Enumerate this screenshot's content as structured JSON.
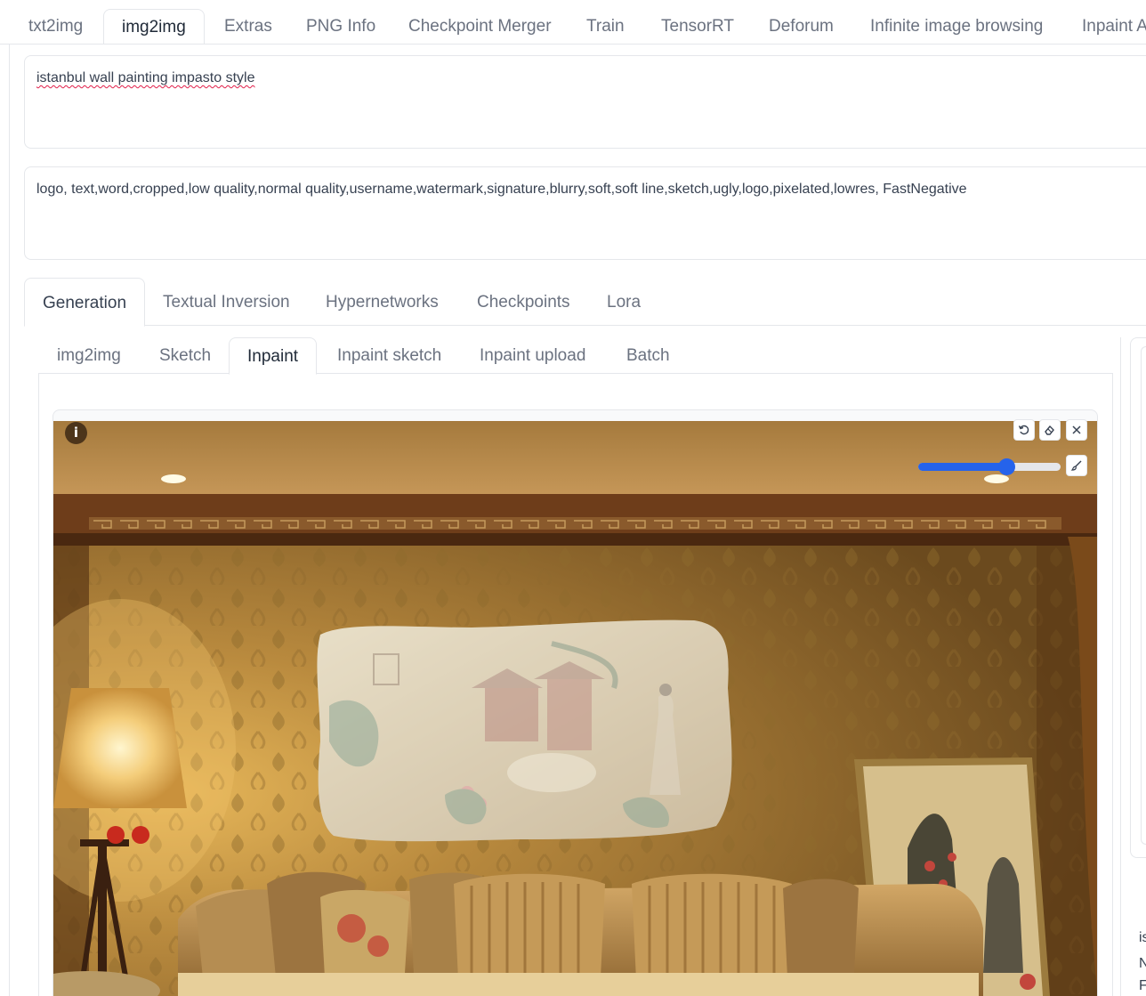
{
  "top_tabs": [
    "txt2img",
    "img2img",
    "Extras",
    "PNG Info",
    "Checkpoint Merger",
    "Train",
    "TensorRT",
    "Deforum",
    "Infinite image browsing",
    "Inpaint A"
  ],
  "prompt": {
    "positive": "istanbul wall painting impasto style",
    "negative": "logo, text,word,cropped,low quality,normal quality,username,watermark,signature,blurry,soft,soft line,sketch,ugly,logo,pixelated,lowres, FastNegative"
  },
  "gen_tabs": [
    "Generation",
    "Textual Inversion",
    "Hypernetworks",
    "Checkpoints",
    "Lora"
  ],
  "sub_tabs": [
    "img2img",
    "Sketch",
    "Inpaint",
    "Inpaint sketch",
    "Inpaint upload",
    "Batch"
  ],
  "canvas": {
    "info_label": "i",
    "brush_size_fraction": 0.62,
    "icons": [
      "undo-icon",
      "eraser-icon",
      "close-icon",
      "brush-icon"
    ]
  },
  "right_text": [
    "is",
    "N",
    "F"
  ],
  "colors": {
    "accent": "#2563eb",
    "tab_inactive": "#6b7280",
    "border": "#e5e7eb",
    "spellcheck": "#e11d48"
  }
}
